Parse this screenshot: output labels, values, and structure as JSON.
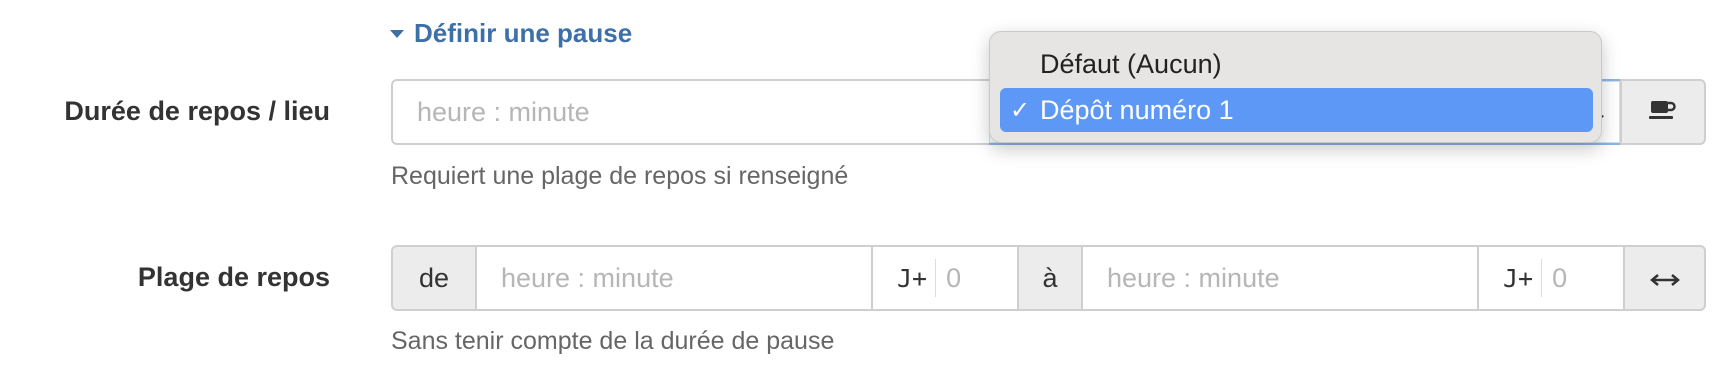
{
  "section_toggle": {
    "label": "Définir une pause"
  },
  "rest_duration": {
    "label": "Durée de repos / lieu",
    "time_placeholder": "heure : minute",
    "help": "Requiert une plage de repos si renseigné",
    "location_select": {
      "selected": "Dépôt numéro 1",
      "options": [
        "Défaut (Aucun)",
        "Dépôt numéro 1"
      ]
    },
    "icon": "coffee-cup-icon"
  },
  "rest_range": {
    "label": "Plage de repos",
    "from_label": "de",
    "from_placeholder": "heure : minute",
    "day_offset_label": "J+",
    "day_offset_placeholder": "0",
    "to_label": "à",
    "to_placeholder": "heure : minute",
    "to_day_offset_label": "J+",
    "to_day_offset_placeholder": "0",
    "help": "Sans tenir compte de la durée de pause",
    "icon": "horizontal-arrows-icon"
  },
  "colors": {
    "accent": "#3d6fa8",
    "selected_option": "#5d98f6"
  }
}
